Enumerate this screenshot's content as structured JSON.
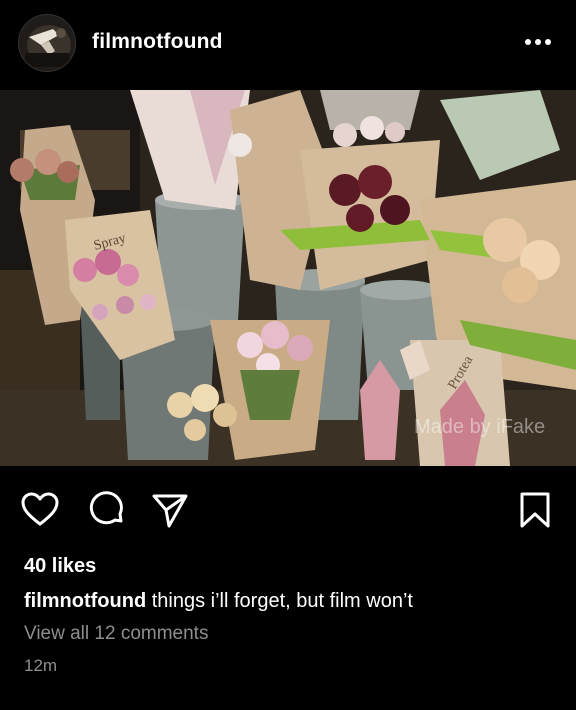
{
  "post": {
    "username": "filmnotfound",
    "avatar_icon": "profile-avatar",
    "more_icon": "more-dots-icon",
    "photo_watermark": "Made by iFake",
    "likes": "40 likes",
    "caption_user": "filmnotfound",
    "caption_text": " things i’ll forget, but film won’t",
    "comments_link": "View all 12 comments",
    "timestamp": "12m"
  },
  "actions": {
    "like_icon": "heart-icon",
    "comment_icon": "comment-icon",
    "share_icon": "share-icon",
    "save_icon": "bookmark-icon"
  },
  "colors": {
    "background": "#000000",
    "text": "#ffffff",
    "muted": "#8e8e8e"
  }
}
